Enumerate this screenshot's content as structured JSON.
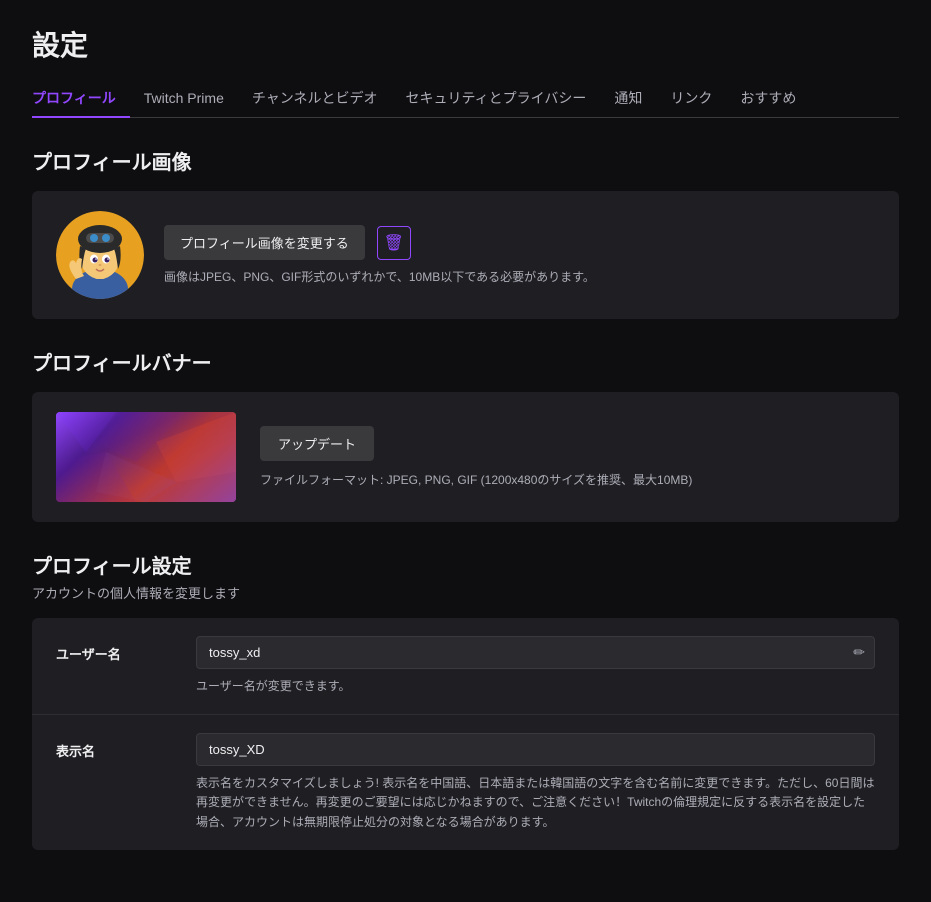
{
  "page": {
    "title": "設定"
  },
  "nav": {
    "tabs": [
      {
        "id": "profile",
        "label": "プロフィール",
        "active": true
      },
      {
        "id": "twitch-prime",
        "label": "Twitch Prime",
        "active": false
      },
      {
        "id": "channel-video",
        "label": "チャンネルとビデオ",
        "active": false
      },
      {
        "id": "security-privacy",
        "label": "セキュリティとプライバシー",
        "active": false
      },
      {
        "id": "notifications",
        "label": "通知",
        "active": false
      },
      {
        "id": "links",
        "label": "リンク",
        "active": false
      },
      {
        "id": "recommendations",
        "label": "おすすめ",
        "active": false
      }
    ]
  },
  "sections": {
    "profile_image": {
      "title": "プロフィール画像",
      "change_button": "プロフィール画像を変更する",
      "hint": "画像はJPEG、PNG、GIF形式のいずれかで、10MB以下である必要があります。"
    },
    "profile_banner": {
      "title": "プロフィールバナー",
      "update_button": "アップデート",
      "hint": "ファイルフォーマット: JPEG, PNG, GIF (1200x480のサイズを推奨、最大10MB)"
    },
    "profile_settings": {
      "title": "プロフィール設定",
      "subtitle": "アカウントの個人情報を変更します",
      "fields": [
        {
          "id": "username",
          "label": "ユーザー名",
          "value": "tossy_xd",
          "hint": "ユーザー名が変更できます。",
          "editable": true
        },
        {
          "id": "display_name",
          "label": "表示名",
          "value": "tossy_XD",
          "hint": "表示名をカスタマイズしましょう! 表示名を中国語、日本語または韓国語の文字を含む名前に変更できます。ただし、60日間は再変更ができません。再変更のご要望には応じかねますので、ご注意ください！Twitchの倫理規定に反する表示名を設定した場合、アカウントは無期限停止処分の対象となる場合があります。",
          "editable": false
        }
      ]
    }
  },
  "icons": {
    "delete": "🗑",
    "edit": "✏"
  }
}
